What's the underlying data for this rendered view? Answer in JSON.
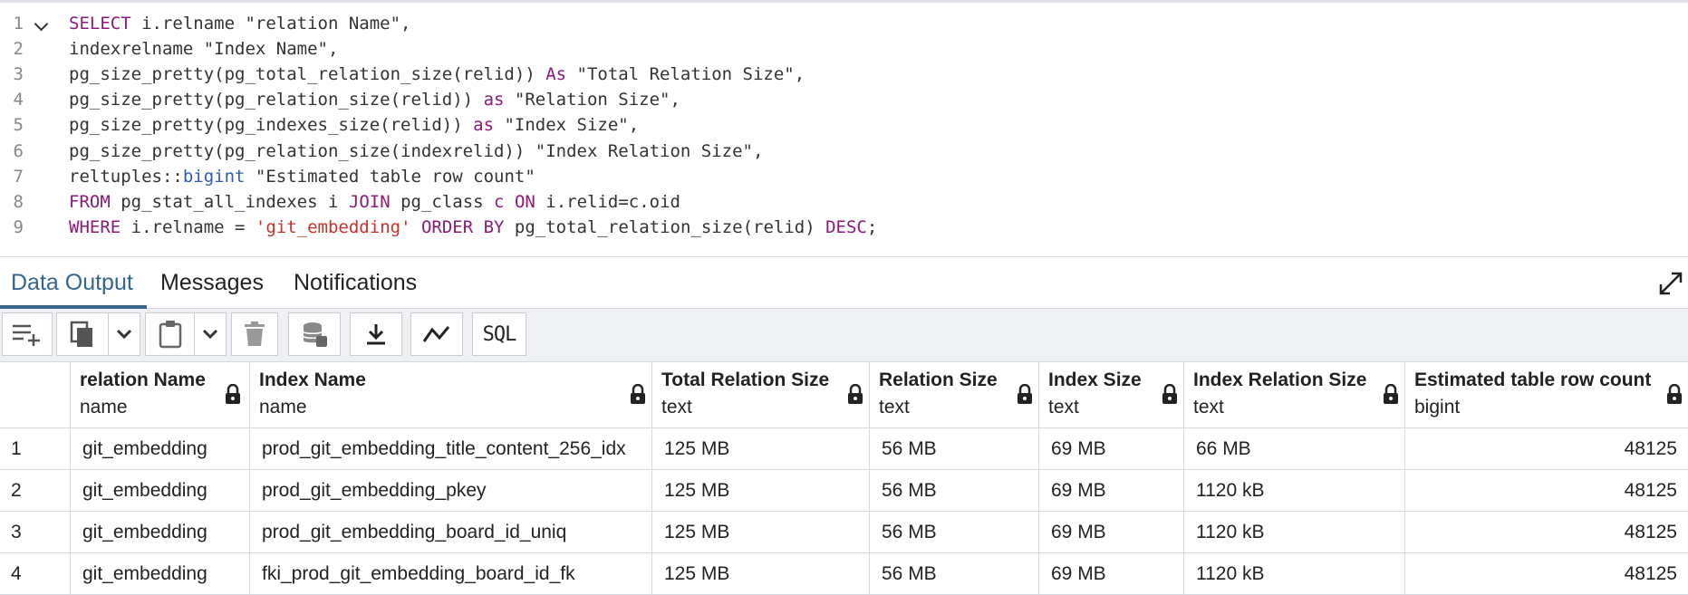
{
  "editor": {
    "lines": [
      {
        "n": "1",
        "tokens": [
          {
            "t": "SELECT",
            "c": "kw"
          },
          {
            "t": " i.relname \"relation Name\",",
            "c": ""
          }
        ]
      },
      {
        "n": "2",
        "tokens": [
          {
            "t": "indexrelname \"Index Name\",",
            "c": ""
          }
        ]
      },
      {
        "n": "3",
        "tokens": [
          {
            "t": "pg_size_pretty(pg_total_relation_size(relid)) ",
            "c": ""
          },
          {
            "t": "As",
            "c": "kw"
          },
          {
            "t": " \"Total Relation Size\",",
            "c": ""
          }
        ]
      },
      {
        "n": "4",
        "tokens": [
          {
            "t": "pg_size_pretty(pg_relation_size(relid)) ",
            "c": ""
          },
          {
            "t": "as",
            "c": "kw"
          },
          {
            "t": " \"Relation Size\",",
            "c": ""
          }
        ]
      },
      {
        "n": "5",
        "tokens": [
          {
            "t": "pg_size_pretty(pg_indexes_size(relid)) ",
            "c": ""
          },
          {
            "t": "as",
            "c": "kw"
          },
          {
            "t": " \"Index Size\",",
            "c": ""
          }
        ]
      },
      {
        "n": "6",
        "tokens": [
          {
            "t": "pg_size_pretty(pg_relation_size(indexrelid)) \"Index Relation Size\",",
            "c": ""
          }
        ]
      },
      {
        "n": "7",
        "tokens": [
          {
            "t": "reltuples::",
            "c": ""
          },
          {
            "t": "bigint",
            "c": "fn"
          },
          {
            "t": " \"Estimated table row count\"",
            "c": ""
          }
        ]
      },
      {
        "n": "8",
        "tokens": [
          {
            "t": "FROM",
            "c": "kw"
          },
          {
            "t": " pg_stat_all_indexes i ",
            "c": ""
          },
          {
            "t": "JOIN",
            "c": "kw"
          },
          {
            "t": " pg_class ",
            "c": ""
          },
          {
            "t": "c",
            "c": "kw"
          },
          {
            "t": " ",
            "c": ""
          },
          {
            "t": "ON",
            "c": "kw"
          },
          {
            "t": " i.relid=c.oid",
            "c": ""
          }
        ]
      },
      {
        "n": "9",
        "tokens": [
          {
            "t": "WHERE",
            "c": "kw"
          },
          {
            "t": " i.relname = ",
            "c": ""
          },
          {
            "t": "'git_embedding'",
            "c": "str"
          },
          {
            "t": " ",
            "c": ""
          },
          {
            "t": "ORDER BY",
            "c": "kw"
          },
          {
            "t": " pg_total_relation_size(relid) ",
            "c": ""
          },
          {
            "t": "DESC",
            "c": "kw"
          },
          {
            "t": ";",
            "c": ""
          }
        ]
      }
    ]
  },
  "tabs": [
    {
      "label": "Data Output",
      "active": true
    },
    {
      "label": "Messages",
      "active": false
    },
    {
      "label": "Notifications",
      "active": false
    }
  ],
  "toolbar": {
    "icons": [
      "add-row-icon",
      "copy-icon",
      "chevron-down-icon",
      "paste-icon",
      "chevron-down-icon",
      "delete-icon",
      "save-data-icon",
      "download-icon",
      "graph-icon",
      "sql-icon"
    ],
    "sql_label": "SQL"
  },
  "grid": {
    "columns": [
      {
        "name": "relation Name",
        "type": "name"
      },
      {
        "name": "Index Name",
        "type": "name"
      },
      {
        "name": "Total Relation Size",
        "type": "text"
      },
      {
        "name": "Relation Size",
        "type": "text"
      },
      {
        "name": "Index Size",
        "type": "text"
      },
      {
        "name": "Index Relation Size",
        "type": "text"
      },
      {
        "name": "Estimated table row count",
        "type": "bigint"
      }
    ],
    "rows": [
      {
        "n": "1",
        "cells": [
          "git_embedding",
          "prod_git_embedding_title_content_256_idx",
          "125 MB",
          "56 MB",
          "69 MB",
          "66 MB",
          "48125"
        ]
      },
      {
        "n": "2",
        "cells": [
          "git_embedding",
          "prod_git_embedding_pkey",
          "125 MB",
          "56 MB",
          "69 MB",
          "1120 kB",
          "48125"
        ]
      },
      {
        "n": "3",
        "cells": [
          "git_embedding",
          "prod_git_embedding_board_id_uniq",
          "125 MB",
          "56 MB",
          "69 MB",
          "1120 kB",
          "48125"
        ]
      },
      {
        "n": "4",
        "cells": [
          "git_embedding",
          "fki_prod_git_embedding_board_id_fk",
          "125 MB",
          "56 MB",
          "69 MB",
          "1120 kB",
          "48125"
        ]
      }
    ]
  }
}
